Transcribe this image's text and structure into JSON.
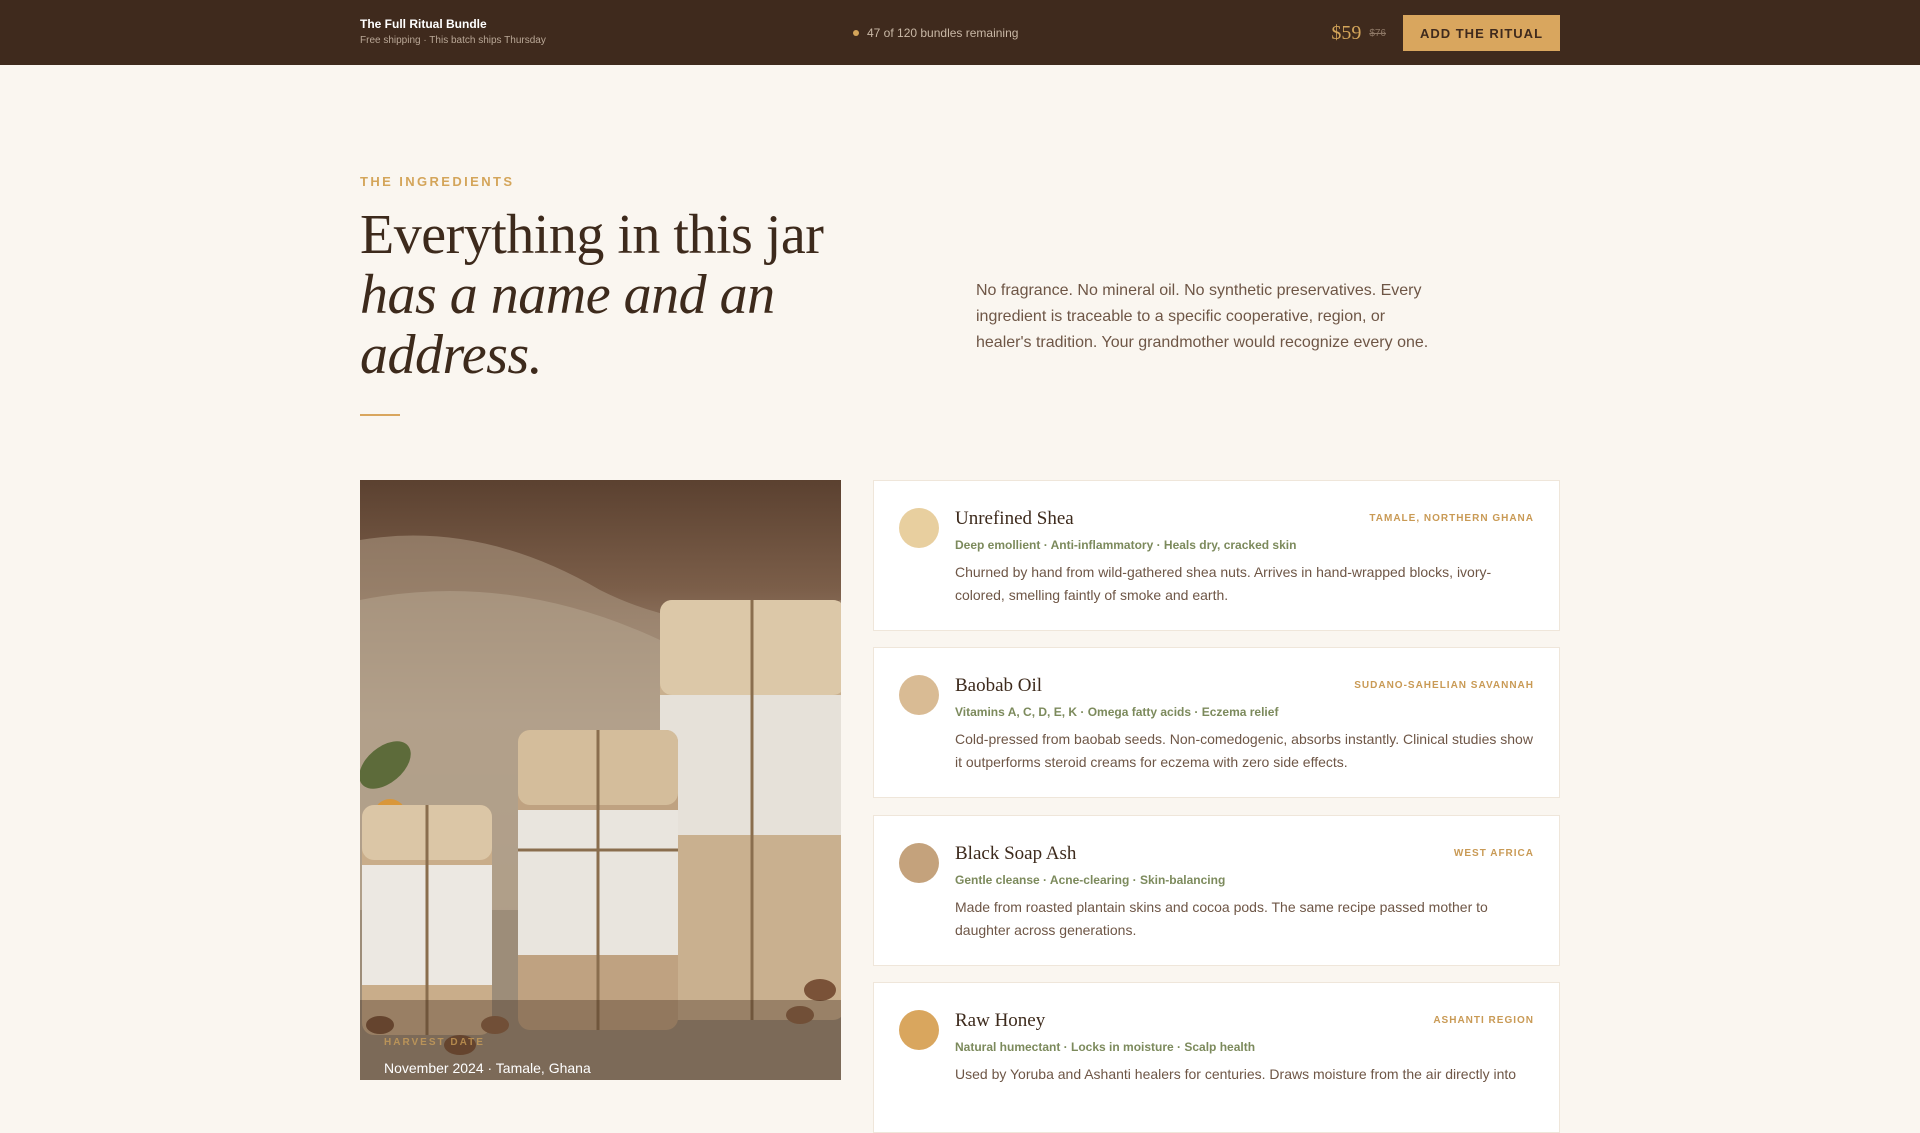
{
  "topbar": {
    "title": "The Full Ritual Bundle",
    "subtitle": "Free shipping · This batch ships Thursday",
    "stock": "47 of 120 bundles remaining",
    "price": "$59",
    "price_old": "$76",
    "cta_label": "ADD THE RITUAL"
  },
  "intro": {
    "eyebrow": "THE INGREDIENTS",
    "headline_line1": "Everything in this jar",
    "headline_line2": "has a name and an",
    "headline_line3": "address.",
    "body": "No fragrance. No mineral oil. No synthetic preservatives. Every ingredient is traceable to a specific cooperative, region, or healer's tradition. Your grandmother would recognize every one."
  },
  "photo": {
    "caption_label": "HARVEST DATE",
    "caption_value": "November 2024 · Tamale, Ghana"
  },
  "ingredients": [
    {
      "name": "Unrefined Shea",
      "origin": "TAMALE, NORTHERN GHANA",
      "tags": "Deep emollient · Anti-inflammatory · Heals dry, cracked skin",
      "desc": "Churned by hand from wild-gathered shea nuts. Arrives in hand-wrapped blocks, ivory-colored, smelling faintly of smoke and earth.",
      "color": "#e8cf9f"
    },
    {
      "name": "Baobab Oil",
      "origin": "SUDANO-SAHELIAN SAVANNAH",
      "tags": "Vitamins A, C, D, E, K · Omega fatty acids · Eczema relief",
      "desc": "Cold-pressed from baobab seeds. Non-comedogenic, absorbs instantly. Clinical studies show it outperforms steroid creams for eczema with zero side effects.",
      "color": "#d9bb94"
    },
    {
      "name": "Black Soap Ash",
      "origin": "WEST AFRICA",
      "tags": "Gentle cleanse · Acne-clearing · Skin-balancing",
      "desc": "Made from roasted plantain skins and cocoa pods. The same recipe passed mother to daughter across generations.",
      "color": "#c4a27c"
    },
    {
      "name": "Raw Honey",
      "origin": "ASHANTI REGION",
      "tags": "Natural humectant · Locks in moisture · Scalp health",
      "desc": "Used by Yoruba and Ashanti healers for centuries. Draws moisture from the air directly into",
      "color": "#d9a65e"
    }
  ]
}
